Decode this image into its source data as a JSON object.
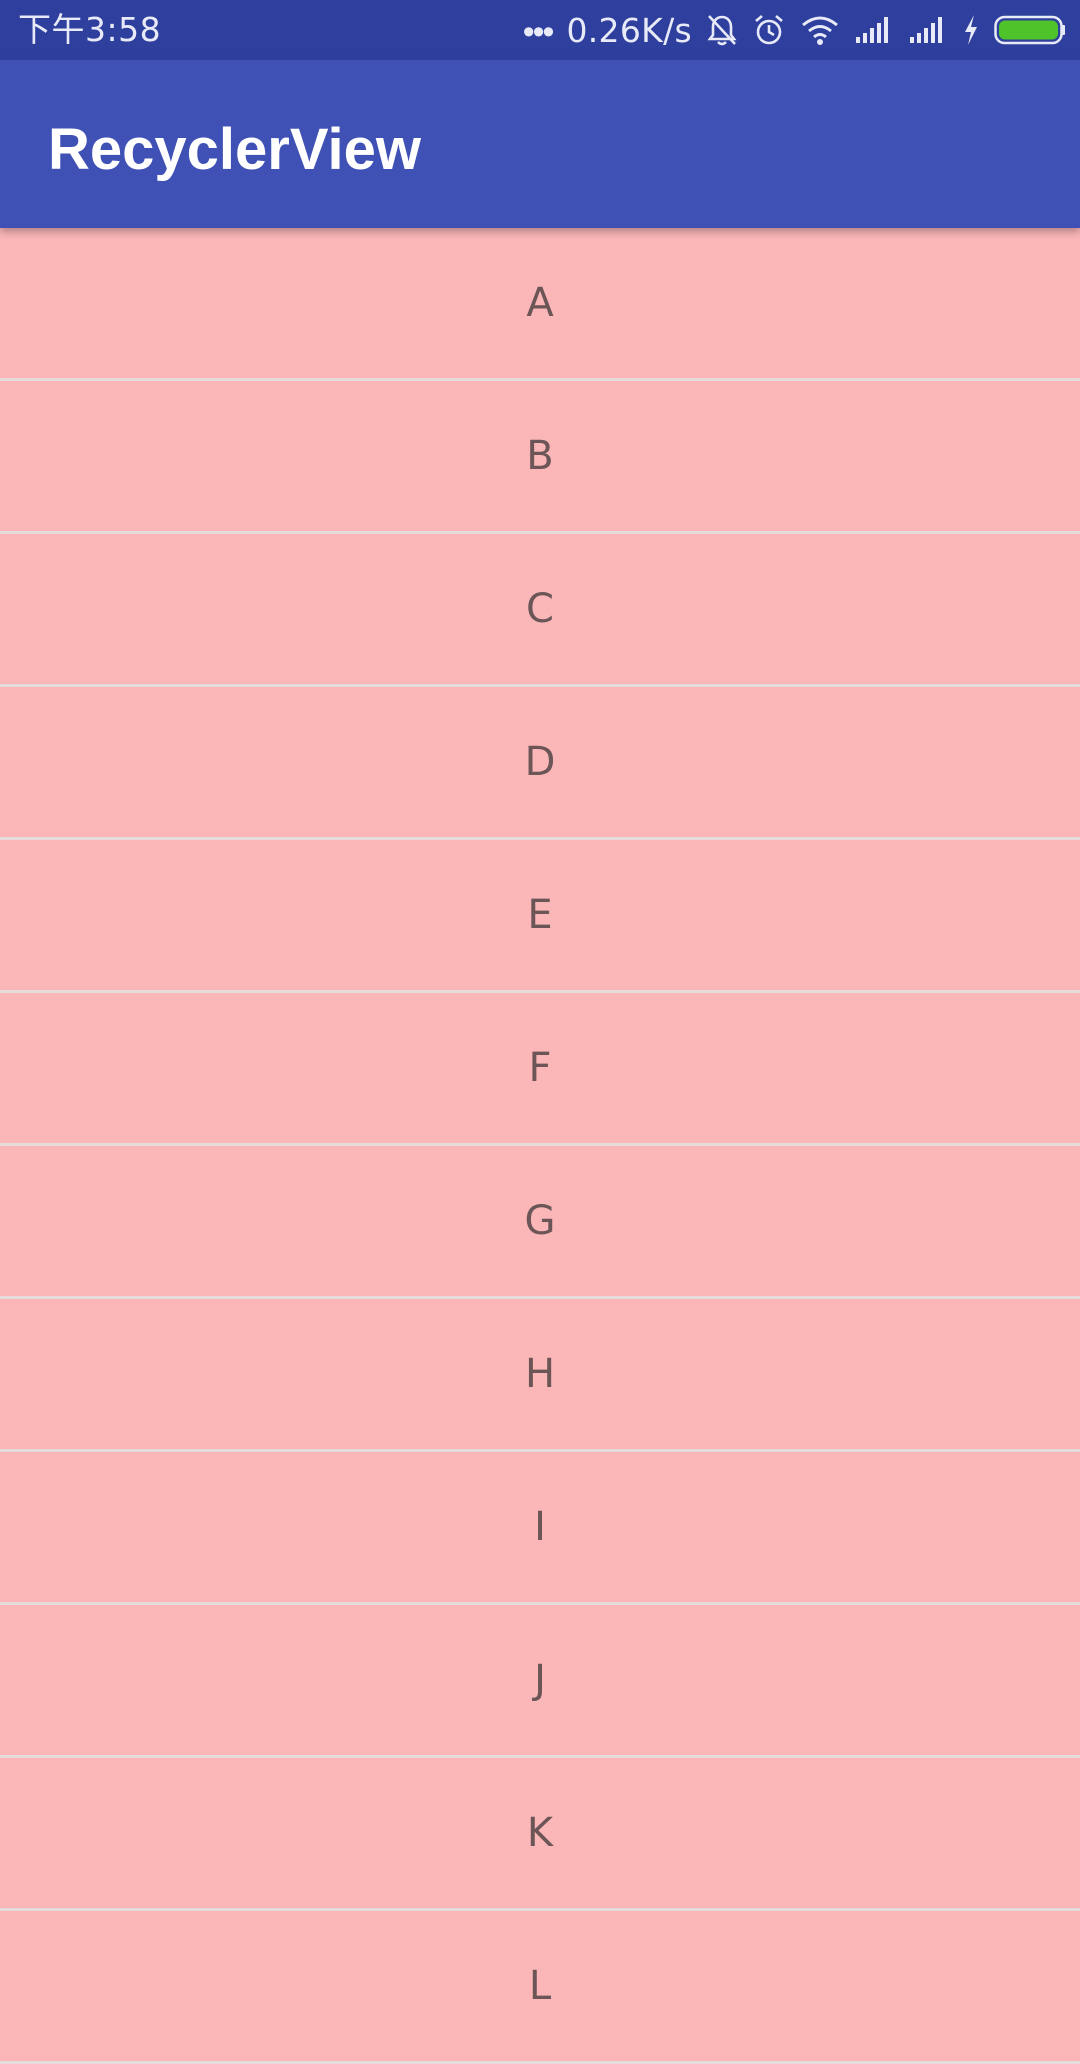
{
  "status_bar": {
    "time": "下午3:58",
    "dots": "•••",
    "net_speed": "0.26K/s",
    "icons": [
      "bell-off-icon",
      "alarm-icon",
      "wifi-icon",
      "signal-icon",
      "signal-icon",
      "charging-icon",
      "battery-icon"
    ],
    "battery_color": "#4fc32a",
    "background": "#2f3f9e"
  },
  "app_bar": {
    "title": "RecyclerView",
    "background": "#3f51b5"
  },
  "list": {
    "item_background": "#fbb7b8",
    "items": [
      {
        "label": "A"
      },
      {
        "label": "B"
      },
      {
        "label": "C"
      },
      {
        "label": "D"
      },
      {
        "label": "E"
      },
      {
        "label": "F"
      },
      {
        "label": "G"
      },
      {
        "label": "H"
      },
      {
        "label": "I"
      },
      {
        "label": "J"
      },
      {
        "label": "K"
      },
      {
        "label": "L"
      }
    ]
  }
}
